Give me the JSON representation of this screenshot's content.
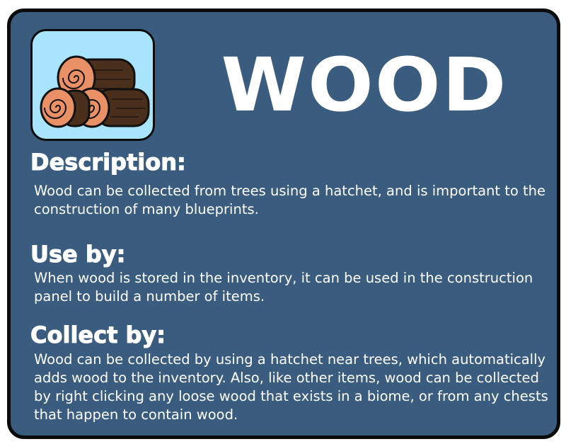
{
  "card": {
    "title": "WOOD",
    "icon": "wood-logs-icon",
    "colors": {
      "background": "#3a5d7f",
      "border": "#0b0b0b",
      "icon_background": "#a8e4fb",
      "log_bark": "#4b2f1d",
      "log_end": "#e99066",
      "text": "#ffffff"
    }
  },
  "sections": {
    "description": {
      "heading": "Description:",
      "text": "Wood can be collected from trees using a hatchet, and is important to the construction of many blueprints."
    },
    "use_by": {
      "heading": "Use by:",
      "text": "When wood is stored in the inventory, it can be used in the construction panel to build a number of items."
    },
    "collect_by": {
      "heading": "Collect by:",
      "text": "Wood can be collected by using a hatchet near trees, which automatically adds wood to the inventory. Also, like other items, wood can be collected by right clicking any loose wood that exists in a biome, or from any chests that happen to contain wood."
    }
  }
}
